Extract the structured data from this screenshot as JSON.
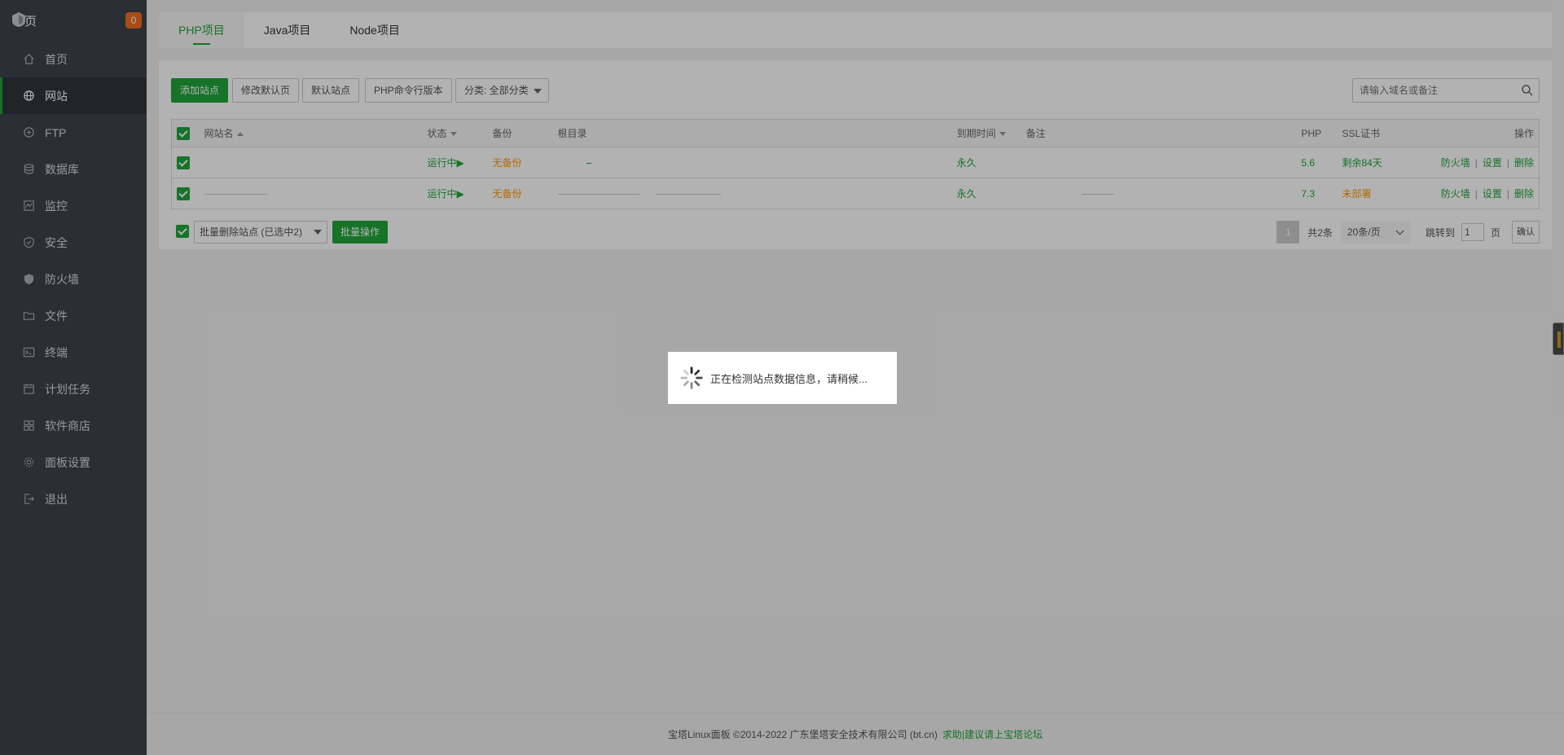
{
  "sidebar": {
    "head_text": "页",
    "badge": "0",
    "items": [
      {
        "label": "首页",
        "icon": "home-icon"
      },
      {
        "label": "网站",
        "icon": "globe-icon",
        "active": true
      },
      {
        "label": "FTP",
        "icon": "ftp-icon"
      },
      {
        "label": "数据库",
        "icon": "database-icon"
      },
      {
        "label": "监控",
        "icon": "monitor-icon"
      },
      {
        "label": "安全",
        "icon": "shield-icon"
      },
      {
        "label": "防火墙",
        "icon": "firewall-icon"
      },
      {
        "label": "文件",
        "icon": "folder-icon"
      },
      {
        "label": "终端",
        "icon": "terminal-icon"
      },
      {
        "label": "计划任务",
        "icon": "calendar-icon"
      },
      {
        "label": "软件商店",
        "icon": "apps-icon"
      },
      {
        "label": "面板设置",
        "icon": "gear-icon"
      },
      {
        "label": "退出",
        "icon": "logout-icon"
      }
    ]
  },
  "tabs": [
    "PHP项目",
    "Java项目",
    "Node项目"
  ],
  "toolbar": {
    "add_site": "添加站点",
    "edit_default_page": "修改默认页",
    "default_site": "默认站点",
    "php_cli_version": "PHP命令行版本",
    "category": "分类: 全部分类",
    "search_placeholder": "请输入域名或备注"
  },
  "table": {
    "headers": {
      "site_name": "网站名",
      "status": "状态",
      "backup": "备份",
      "root": "根目录",
      "expire": "到期时间",
      "remark": "备注",
      "php": "PHP",
      "ssl": "SSL证书",
      "actions": "操作"
    },
    "rows": [
      {
        "status": "运行中▶",
        "backup": "无备份",
        "expire": "永久",
        "php": "5.6",
        "ssl": "剩余84天",
        "ssl_color": "green"
      },
      {
        "status": "运行中▶",
        "backup": "无备份",
        "expire": "永久",
        "php": "7.3",
        "ssl": "未部署",
        "ssl_color": "orange"
      }
    ],
    "action_labels": {
      "firewall": "防火墙",
      "settings": "设置",
      "delete": "删除"
    }
  },
  "batch": {
    "select": "批量删除站点 (已选中2)",
    "button": "批量操作"
  },
  "pager": {
    "current": "1",
    "total": "共2条",
    "per_page": "20条/页",
    "jump_label": "跳转到",
    "jump_value": "1",
    "page_suffix": "页",
    "confirm": "确认"
  },
  "footer": {
    "copyright": "宝塔Linux面板 ©2014-2022 广东堡塔安全技术有限公司 (bt.cn)",
    "link": "求助|建议请上宝塔论坛"
  },
  "loading": {
    "message": "正在检测站点数据信息，请稍候..."
  },
  "colors": {
    "accent": "#20a53a",
    "sidebar_bg": "#3c444d",
    "badge": "#f26d21",
    "warning": "#ff9900"
  }
}
